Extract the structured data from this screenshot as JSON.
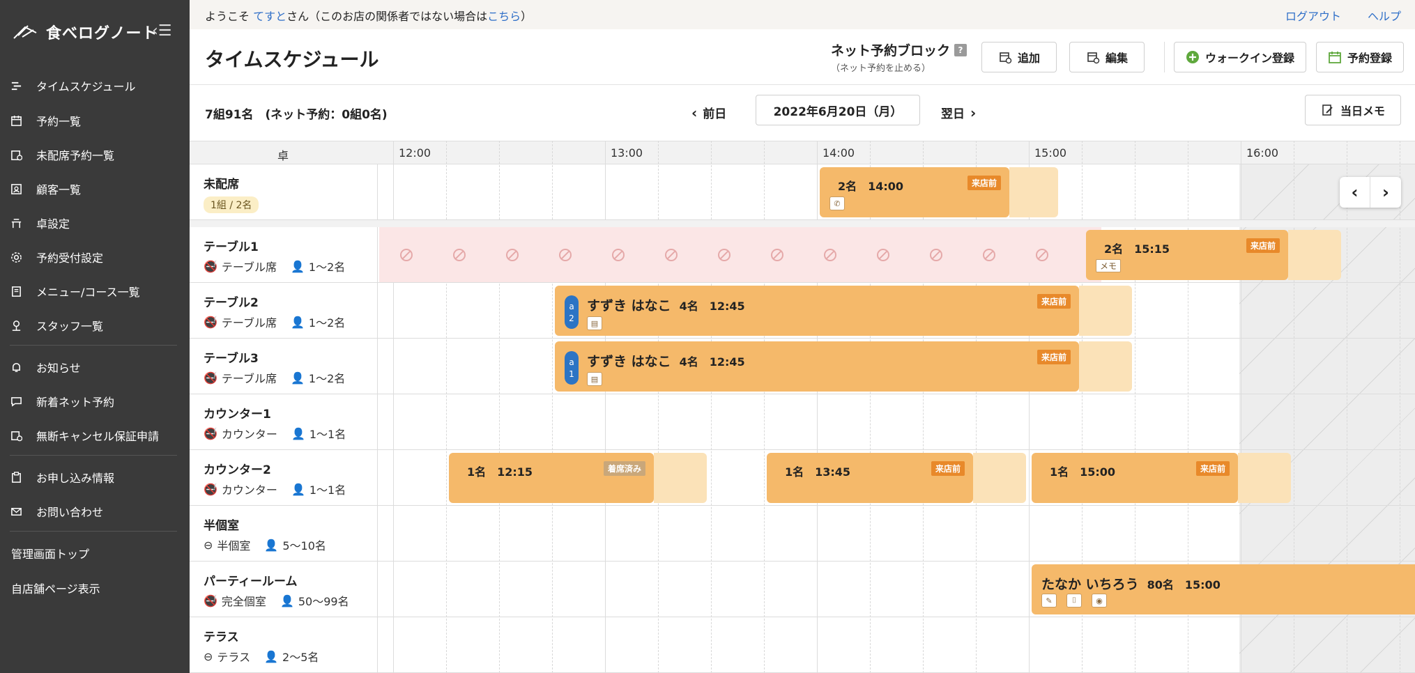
{
  "app": {
    "logo_text": "食べログノート"
  },
  "sidebar": {
    "items": [
      {
        "label": "タイムスケジュール",
        "icon": "timeline-icon"
      },
      {
        "label": "予約一覧",
        "icon": "calendar-icon"
      },
      {
        "label": "未配席予約一覧",
        "icon": "calendar-alert-icon"
      },
      {
        "label": "顧客一覧",
        "icon": "address-book-icon"
      },
      {
        "label": "卓設定",
        "icon": "table-icon"
      },
      {
        "label": "予約受付設定",
        "icon": "gear-icon"
      },
      {
        "label": "メニュー/コース一覧",
        "icon": "menu-book-icon"
      },
      {
        "label": "スタッフ一覧",
        "icon": "staff-icon"
      },
      {
        "label": "お知らせ",
        "icon": "bell-icon"
      },
      {
        "label": "新着ネット予約",
        "icon": "chat-icon"
      },
      {
        "label": "無断キャンセル保証申請",
        "icon": "calendar-yen-icon"
      },
      {
        "label": "お申し込み情報",
        "icon": "clipboard-icon"
      },
      {
        "label": "お問い合わせ",
        "icon": "mail-icon"
      }
    ],
    "plain_links": [
      "管理画面トップ",
      "自店舗ページ表示"
    ]
  },
  "topbar": {
    "welcome_prefix": "ようこそ ",
    "user_name": "てすと",
    "welcome_middle": "さん（このお店の関係者ではない場合は",
    "here_link": "こちら",
    "welcome_suffix": "）",
    "logout": "ログアウト",
    "help": "ヘルプ"
  },
  "header": {
    "title": "タイムスケジュール",
    "block_title": "ネット予約ブロック",
    "block_help": "?",
    "block_sub": "（ネット予約を止める）",
    "add_label": "追加",
    "edit_label": "編集",
    "walkin_label": "ウォークイン登録",
    "reserve_label": "予約登録"
  },
  "datebar": {
    "summary": "7組91名　(ネット予約：0組0名)",
    "prev_label": "前日",
    "date": "2022年6月20日（月）",
    "next_label": "翌日",
    "memo_label": "当日メモ"
  },
  "grid": {
    "table_header": "卓",
    "hours": [
      "12:00",
      "13:00",
      "14:00",
      "15:00",
      "16:00"
    ],
    "rows": [
      {
        "name": "未配席",
        "badge": "1組 / 2名"
      },
      {
        "name": "テーブル1",
        "type": "テーブル席",
        "cap": "1〜2名",
        "smoke": "no-smoking"
      },
      {
        "name": "テーブル2",
        "type": "テーブル席",
        "cap": "1〜2名",
        "smoke": "no-smoking"
      },
      {
        "name": "テーブル3",
        "type": "テーブル席",
        "cap": "1〜2名",
        "smoke": "no-smoking"
      },
      {
        "name": "カウンター1",
        "type": "カウンター",
        "cap": "1〜1名",
        "smoke": "no-smoking"
      },
      {
        "name": "カウンター2",
        "type": "カウンター",
        "cap": "1〜1名",
        "smoke": "no-smoking"
      },
      {
        "name": "半個室",
        "type": "半個室",
        "cap": "5〜10名",
        "smoke": "separated"
      },
      {
        "name": "パーティールーム",
        "type": "完全個室",
        "cap": "50〜99名",
        "smoke": "no-smoking"
      },
      {
        "name": "テラス",
        "type": "テラス",
        "cap": "2〜5名",
        "smoke": "separated"
      }
    ],
    "reservations": {
      "unassigned": {
        "text": "2名　14:00",
        "status": "来店前",
        "icon": "phone-icon"
      },
      "t1": {
        "text": "2名　15:15",
        "status": "来店前",
        "memo": "メモ"
      },
      "t2": {
        "name": "すずき はなこ",
        "text": "4名　12:45",
        "status": "来店前",
        "pill_top": "a",
        "pill_bottom": "2",
        "icon": "course-icon"
      },
      "t3": {
        "name": "すずき はなこ",
        "text": "4名　12:45",
        "status": "来店前",
        "pill_top": "a",
        "pill_bottom": "1",
        "icon": "course-icon"
      },
      "c2a": {
        "text": "1名　12:15",
        "status": "着席済み"
      },
      "c2b": {
        "text": "1名　13:45",
        "status": "来店前"
      },
      "c2c": {
        "text": "1名　15:00",
        "status": "来店前"
      },
      "party": {
        "name": "たなか いちろう",
        "text": "80名　15:00",
        "icons": [
          "pen-icon",
          "chair-icon",
          "eye-icon"
        ]
      }
    }
  }
}
